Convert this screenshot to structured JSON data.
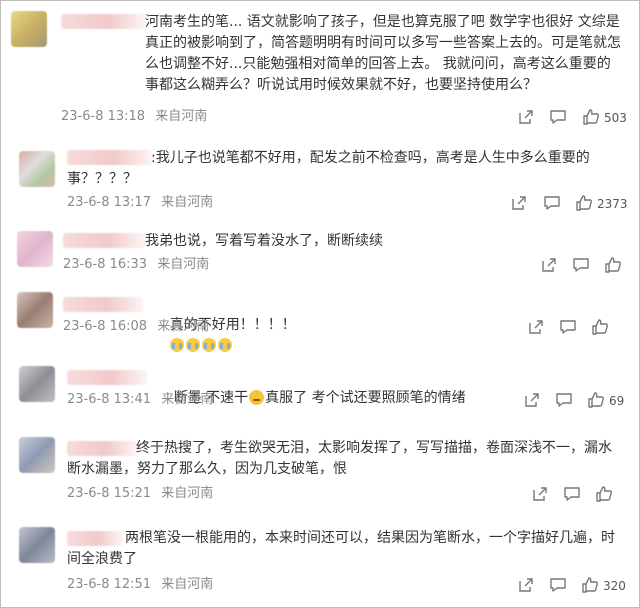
{
  "comments": [
    {
      "name": "redacted",
      "text": "河南考生的笔... 语文就影响了孩子，但是也算克服了吧 数学字也很好 文综是真正的被影响到了，简答题明明有时间可以多写一些答案上去的。可是笔就怎么也调整不好...只能勉强相对简单的回答上去。 我就问问，高考这么重要的事都这么糊弄么？听说试用时候效果就不好，也要坚持使用么？",
      "time": "23-6-8 13:18",
      "location": "来自河南",
      "likes": "503",
      "avatar_color": "#d8c37a"
    },
    {
      "name": "redacted",
      "text": ":我儿子也说笔都不好用，配发之前不检查吗，高考是人生中多么重要的事？？？？",
      "time": "23-6-8 13:17",
      "location": "来自河南",
      "likes": "2373",
      "avatar_color": "#c9b6a8"
    },
    {
      "name": "redacted",
      "text": "我弟也说，写着写着没水了，断断续续",
      "time": "23-6-8 16:33",
      "location": "来自河南",
      "likes": "",
      "avatar_color": "#e8c6d8"
    },
    {
      "name": "redacted",
      "text": "真的不好用！！！！",
      "time": "23-6-8 16:08",
      "location": "来自河南",
      "likes": "",
      "avatar_color": "#b9a39b"
    },
    {
      "name": "redacted",
      "text_parts": [
        "断墨 不速干",
        "真服了 考个试还要照顾笔的情绪"
      ],
      "time": "23-6-8 13:41",
      "location": "来自河南",
      "likes": "69",
      "avatar_color": "#a8aab0"
    },
    {
      "name": "redacted",
      "text": "终于热搜了，考生欲哭无泪，太影响发挥了，写写描描，卷面深浅不一，漏水断水漏墨，努力了那么久，因为几支破笔，恨",
      "time": "23-6-8 15:21",
      "location": "来自河南",
      "likes": "",
      "avatar_color": "#b8c2d6"
    },
    {
      "name": "redacted",
      "text": "两根笔没一根能用的，本来时间还可以，结果因为笔断水，一个字描好几遍，时间全浪费了",
      "time": "23-6-8 12:51",
      "location": "来自河南",
      "likes": "320",
      "avatar_color": "#a9b0bf"
    }
  ],
  "icons": {
    "share": "share-icon",
    "comment": "comment-icon",
    "like": "like-icon"
  }
}
